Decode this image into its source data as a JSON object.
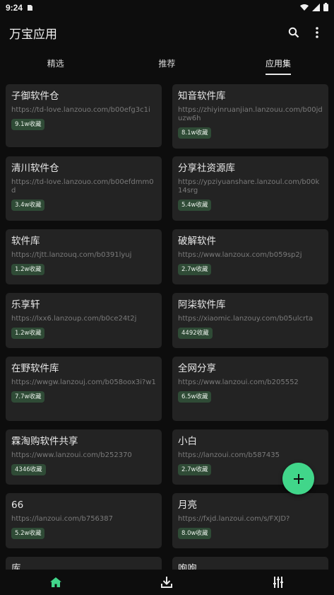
{
  "status": {
    "time": "9:24"
  },
  "app": {
    "title": "万宝应用"
  },
  "tabs": [
    {
      "label": "精选",
      "active": false
    },
    {
      "label": "推荐",
      "active": false
    },
    {
      "label": "应用集",
      "active": true
    }
  ],
  "cards": [
    {
      "title": "子御软件仓",
      "url": "https://td-love.lanzouo.com/b00efg3c1i",
      "badge": "9.1w收藏"
    },
    {
      "title": "知音软件库",
      "url": "https://zhiyinruanjian.lanzouu.com/b00jduzw6h",
      "badge": "8.1w收藏"
    },
    {
      "title": "清川软件仓",
      "url": "https://td-love.lanzouo.com/b00efdmm0d",
      "badge": "3.4w收藏"
    },
    {
      "title": "分享社资源库",
      "url": "https://ypziyuanshare.lanzoul.com/b00k14srg",
      "badge": "5.4w收藏"
    },
    {
      "title": "软件库",
      "url": "https://tjtt.lanzouq.com/b0391lyuj",
      "badge": "1.2w收藏"
    },
    {
      "title": "破解软件",
      "url": "https://www.lanzoux.com/b059sp2j",
      "badge": "2.7w收藏"
    },
    {
      "title": "乐享轩",
      "url": "https://lxx6.lanzoup.com/b0ce24t2j",
      "badge": "1.2w收藏"
    },
    {
      "title": "阿柒软件库",
      "url": "https://xiaomic.lanzouy.com/b05ulcrta",
      "badge": "4492收藏"
    },
    {
      "title": "在野软件库",
      "url": "https://wwgw.lanzouj.com/b058oox3i?w1",
      "badge": "7.7w收藏"
    },
    {
      "title": "全网分享",
      "url": "https://www.lanzoui.com/b205552",
      "badge": "6.5w收藏"
    },
    {
      "title": "霖淘购软件共享",
      "url": "https://www.lanzoui.com/b252370",
      "badge": "4346收藏"
    },
    {
      "title": "小白",
      "url": "https://lanzoui.com/b587435",
      "badge": "2.7w收藏"
    },
    {
      "title": "66",
      "url": "https://lanzoui.com/b756387",
      "badge": "5.2w收藏"
    },
    {
      "title": "月亮",
      "url": "https://fxjd.lanzoui.com/s/FXJD?",
      "badge": "8.0w收藏"
    },
    {
      "title": "库",
      "url": "",
      "badge": ""
    },
    {
      "title": "咆咆",
      "url": "",
      "badge": ""
    }
  ],
  "icons": {
    "search": "search-icon",
    "more": "more-vert-icon",
    "fab": "plus-icon",
    "nav": [
      "home-icon",
      "download-icon",
      "settings-sliders-icon"
    ]
  },
  "colors": {
    "accent": "#41d68a",
    "badge_bg": "#2f4b36",
    "card_bg": "#232323",
    "background": "#0d0d0d"
  }
}
